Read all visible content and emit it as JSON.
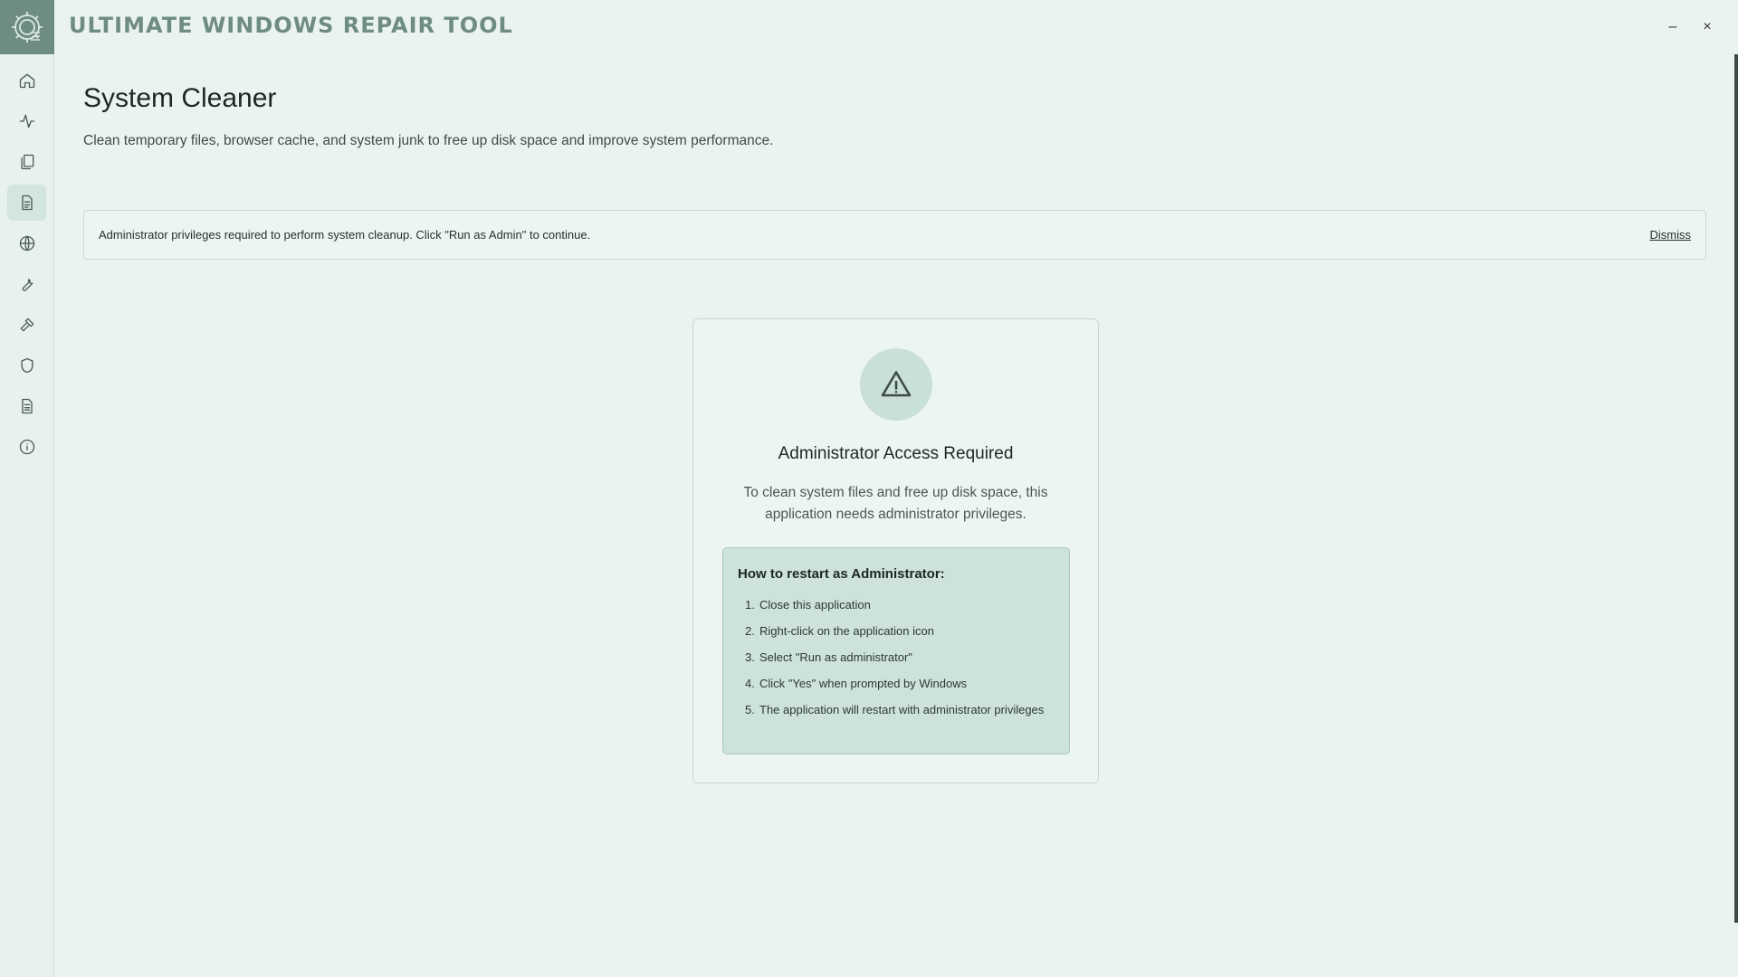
{
  "app": {
    "title": "ULTIMATE WINDOWS REPAIR TOOL",
    "window_controls": {
      "minimize": "–",
      "close": "×"
    }
  },
  "sidebar": {
    "items": [
      {
        "icon": "home-icon",
        "active": false
      },
      {
        "icon": "activity-icon",
        "active": false
      },
      {
        "icon": "copy-icon",
        "active": false
      },
      {
        "icon": "document-icon",
        "active": true
      },
      {
        "icon": "globe-icon",
        "active": false
      },
      {
        "icon": "wrench-icon",
        "active": false
      },
      {
        "icon": "hammer-icon",
        "active": false
      },
      {
        "icon": "shield-icon",
        "active": false
      },
      {
        "icon": "file-text-icon",
        "active": false
      },
      {
        "icon": "info-icon",
        "active": false
      }
    ]
  },
  "page": {
    "title": "System Cleaner",
    "subtitle": "Clean temporary files, browser cache, and system junk to free up disk space and improve system performance."
  },
  "alert": {
    "text": "Administrator privileges required to perform system cleanup. Click \"Run as Admin\" to continue.",
    "dismiss_label": "Dismiss"
  },
  "card": {
    "title": "Administrator Access Required",
    "description": "To clean system files and free up disk space, this application needs administrator privileges.",
    "howto": {
      "title": "How to restart as Administrator:",
      "steps": [
        "Close this application",
        "Right-click on the application icon",
        "Select \"Run as administrator\"",
        "Click \"Yes\" when prompted by Windows",
        "The application will restart with administrator privileges"
      ]
    }
  },
  "colors": {
    "background": "#ebf3f1",
    "accent": "#6f8c84",
    "panel": "#cde2dc"
  }
}
